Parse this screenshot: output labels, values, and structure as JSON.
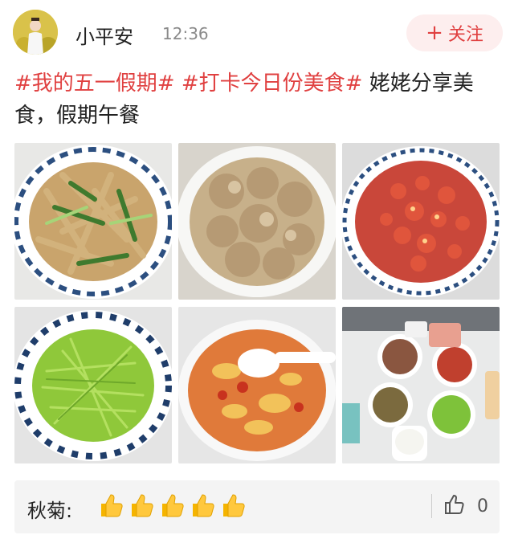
{
  "user": {
    "name": "小平安",
    "time": "12:36",
    "follow_label": "关注",
    "follow_icon": "plus-icon"
  },
  "post": {
    "tag1": "#我的五一假期#",
    "tag2": "#打卡今日份美食#",
    "text": "姥姥分享美食，假期午餐"
  },
  "photos": [
    {
      "subject": "stir-fried meat with green peppers"
    },
    {
      "subject": "steamed pork ribs"
    },
    {
      "subject": "spicy crayfish"
    },
    {
      "subject": "shredded lettuce stem"
    },
    {
      "subject": "tomato egg soup"
    },
    {
      "subject": "table of lunch dishes"
    }
  ],
  "comment": {
    "author": "秋菊:",
    "emoji": "thumbs-up-icon",
    "emoji_count": 5,
    "like_count": "0"
  },
  "colors": {
    "accent": "#e04040",
    "follow_bg": "#fdeeee"
  }
}
